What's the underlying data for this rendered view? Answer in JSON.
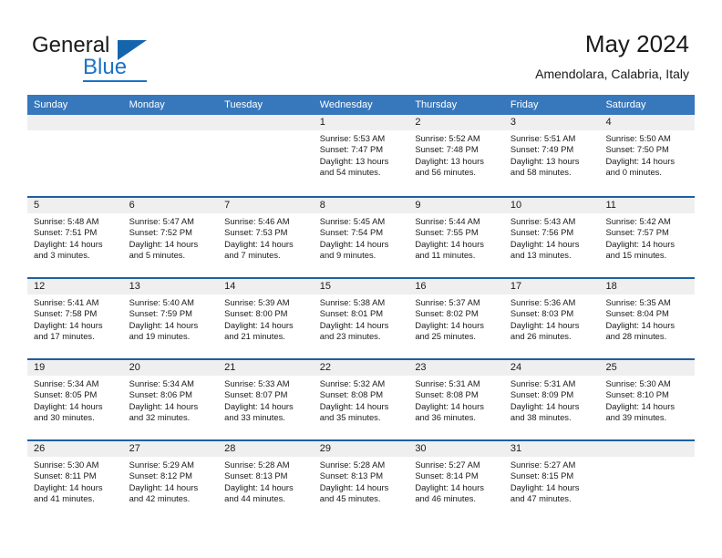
{
  "brand": {
    "name_part1": "General",
    "name_part2": "Blue",
    "accent_color": "#1c72c4",
    "triangle_color": "#1565ad"
  },
  "header": {
    "title": "May 2024",
    "subtitle": "Amendolara, Calabria, Italy"
  },
  "theme": {
    "header_row_bg": "#3778bd",
    "row_divider": "#1f5fa0",
    "day_number_bg": "#efefef"
  },
  "weekdays": [
    "Sunday",
    "Monday",
    "Tuesday",
    "Wednesday",
    "Thursday",
    "Friday",
    "Saturday"
  ],
  "weeks": [
    [
      {
        "day": "",
        "sunrise": "",
        "sunset": "",
        "daylight_line1": "",
        "daylight_line2": ""
      },
      {
        "day": "",
        "sunrise": "",
        "sunset": "",
        "daylight_line1": "",
        "daylight_line2": ""
      },
      {
        "day": "",
        "sunrise": "",
        "sunset": "",
        "daylight_line1": "",
        "daylight_line2": ""
      },
      {
        "day": "1",
        "sunrise": "Sunrise: 5:53 AM",
        "sunset": "Sunset: 7:47 PM",
        "daylight_line1": "Daylight: 13 hours",
        "daylight_line2": "and 54 minutes."
      },
      {
        "day": "2",
        "sunrise": "Sunrise: 5:52 AM",
        "sunset": "Sunset: 7:48 PM",
        "daylight_line1": "Daylight: 13 hours",
        "daylight_line2": "and 56 minutes."
      },
      {
        "day": "3",
        "sunrise": "Sunrise: 5:51 AM",
        "sunset": "Sunset: 7:49 PM",
        "daylight_line1": "Daylight: 13 hours",
        "daylight_line2": "and 58 minutes."
      },
      {
        "day": "4",
        "sunrise": "Sunrise: 5:50 AM",
        "sunset": "Sunset: 7:50 PM",
        "daylight_line1": "Daylight: 14 hours",
        "daylight_line2": "and 0 minutes."
      }
    ],
    [
      {
        "day": "5",
        "sunrise": "Sunrise: 5:48 AM",
        "sunset": "Sunset: 7:51 PM",
        "daylight_line1": "Daylight: 14 hours",
        "daylight_line2": "and 3 minutes."
      },
      {
        "day": "6",
        "sunrise": "Sunrise: 5:47 AM",
        "sunset": "Sunset: 7:52 PM",
        "daylight_line1": "Daylight: 14 hours",
        "daylight_line2": "and 5 minutes."
      },
      {
        "day": "7",
        "sunrise": "Sunrise: 5:46 AM",
        "sunset": "Sunset: 7:53 PM",
        "daylight_line1": "Daylight: 14 hours",
        "daylight_line2": "and 7 minutes."
      },
      {
        "day": "8",
        "sunrise": "Sunrise: 5:45 AM",
        "sunset": "Sunset: 7:54 PM",
        "daylight_line1": "Daylight: 14 hours",
        "daylight_line2": "and 9 minutes."
      },
      {
        "day": "9",
        "sunrise": "Sunrise: 5:44 AM",
        "sunset": "Sunset: 7:55 PM",
        "daylight_line1": "Daylight: 14 hours",
        "daylight_line2": "and 11 minutes."
      },
      {
        "day": "10",
        "sunrise": "Sunrise: 5:43 AM",
        "sunset": "Sunset: 7:56 PM",
        "daylight_line1": "Daylight: 14 hours",
        "daylight_line2": "and 13 minutes."
      },
      {
        "day": "11",
        "sunrise": "Sunrise: 5:42 AM",
        "sunset": "Sunset: 7:57 PM",
        "daylight_line1": "Daylight: 14 hours",
        "daylight_line2": "and 15 minutes."
      }
    ],
    [
      {
        "day": "12",
        "sunrise": "Sunrise: 5:41 AM",
        "sunset": "Sunset: 7:58 PM",
        "daylight_line1": "Daylight: 14 hours",
        "daylight_line2": "and 17 minutes."
      },
      {
        "day": "13",
        "sunrise": "Sunrise: 5:40 AM",
        "sunset": "Sunset: 7:59 PM",
        "daylight_line1": "Daylight: 14 hours",
        "daylight_line2": "and 19 minutes."
      },
      {
        "day": "14",
        "sunrise": "Sunrise: 5:39 AM",
        "sunset": "Sunset: 8:00 PM",
        "daylight_line1": "Daylight: 14 hours",
        "daylight_line2": "and 21 minutes."
      },
      {
        "day": "15",
        "sunrise": "Sunrise: 5:38 AM",
        "sunset": "Sunset: 8:01 PM",
        "daylight_line1": "Daylight: 14 hours",
        "daylight_line2": "and 23 minutes."
      },
      {
        "day": "16",
        "sunrise": "Sunrise: 5:37 AM",
        "sunset": "Sunset: 8:02 PM",
        "daylight_line1": "Daylight: 14 hours",
        "daylight_line2": "and 25 minutes."
      },
      {
        "day": "17",
        "sunrise": "Sunrise: 5:36 AM",
        "sunset": "Sunset: 8:03 PM",
        "daylight_line1": "Daylight: 14 hours",
        "daylight_line2": "and 26 minutes."
      },
      {
        "day": "18",
        "sunrise": "Sunrise: 5:35 AM",
        "sunset": "Sunset: 8:04 PM",
        "daylight_line1": "Daylight: 14 hours",
        "daylight_line2": "and 28 minutes."
      }
    ],
    [
      {
        "day": "19",
        "sunrise": "Sunrise: 5:34 AM",
        "sunset": "Sunset: 8:05 PM",
        "daylight_line1": "Daylight: 14 hours",
        "daylight_line2": "and 30 minutes."
      },
      {
        "day": "20",
        "sunrise": "Sunrise: 5:34 AM",
        "sunset": "Sunset: 8:06 PM",
        "daylight_line1": "Daylight: 14 hours",
        "daylight_line2": "and 32 minutes."
      },
      {
        "day": "21",
        "sunrise": "Sunrise: 5:33 AM",
        "sunset": "Sunset: 8:07 PM",
        "daylight_line1": "Daylight: 14 hours",
        "daylight_line2": "and 33 minutes."
      },
      {
        "day": "22",
        "sunrise": "Sunrise: 5:32 AM",
        "sunset": "Sunset: 8:08 PM",
        "daylight_line1": "Daylight: 14 hours",
        "daylight_line2": "and 35 minutes."
      },
      {
        "day": "23",
        "sunrise": "Sunrise: 5:31 AM",
        "sunset": "Sunset: 8:08 PM",
        "daylight_line1": "Daylight: 14 hours",
        "daylight_line2": "and 36 minutes."
      },
      {
        "day": "24",
        "sunrise": "Sunrise: 5:31 AM",
        "sunset": "Sunset: 8:09 PM",
        "daylight_line1": "Daylight: 14 hours",
        "daylight_line2": "and 38 minutes."
      },
      {
        "day": "25",
        "sunrise": "Sunrise: 5:30 AM",
        "sunset": "Sunset: 8:10 PM",
        "daylight_line1": "Daylight: 14 hours",
        "daylight_line2": "and 39 minutes."
      }
    ],
    [
      {
        "day": "26",
        "sunrise": "Sunrise: 5:30 AM",
        "sunset": "Sunset: 8:11 PM",
        "daylight_line1": "Daylight: 14 hours",
        "daylight_line2": "and 41 minutes."
      },
      {
        "day": "27",
        "sunrise": "Sunrise: 5:29 AM",
        "sunset": "Sunset: 8:12 PM",
        "daylight_line1": "Daylight: 14 hours",
        "daylight_line2": "and 42 minutes."
      },
      {
        "day": "28",
        "sunrise": "Sunrise: 5:28 AM",
        "sunset": "Sunset: 8:13 PM",
        "daylight_line1": "Daylight: 14 hours",
        "daylight_line2": "and 44 minutes."
      },
      {
        "day": "29",
        "sunrise": "Sunrise: 5:28 AM",
        "sunset": "Sunset: 8:13 PM",
        "daylight_line1": "Daylight: 14 hours",
        "daylight_line2": "and 45 minutes."
      },
      {
        "day": "30",
        "sunrise": "Sunrise: 5:27 AM",
        "sunset": "Sunset: 8:14 PM",
        "daylight_line1": "Daylight: 14 hours",
        "daylight_line2": "and 46 minutes."
      },
      {
        "day": "31",
        "sunrise": "Sunrise: 5:27 AM",
        "sunset": "Sunset: 8:15 PM",
        "daylight_line1": "Daylight: 14 hours",
        "daylight_line2": "and 47 minutes."
      },
      {
        "day": "",
        "sunrise": "",
        "sunset": "",
        "daylight_line1": "",
        "daylight_line2": ""
      }
    ]
  ]
}
